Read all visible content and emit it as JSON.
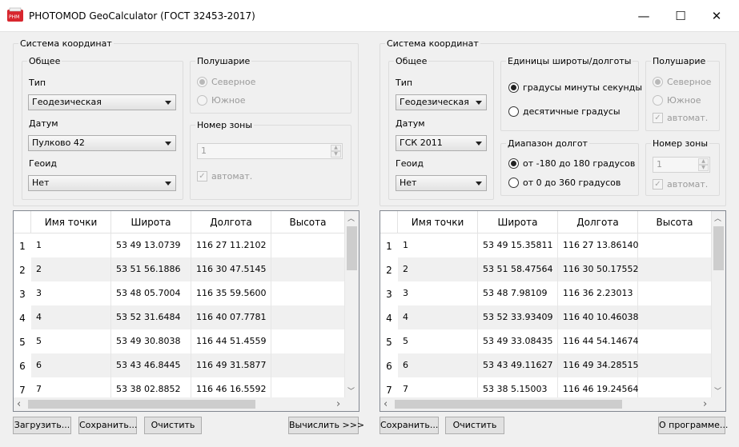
{
  "window": {
    "title": "PHOTOMOD GeoCalculator (ГОСТ 32453-2017)",
    "minimize": "—",
    "maximize": "☐",
    "close": "✕"
  },
  "left": {
    "group_title": "Система координат",
    "general_title": "Общее",
    "type_label": "Тип",
    "type_value": "Геодезическая",
    "datum_label": "Датум",
    "datum_value": "Пулково 42",
    "geoid_label": "Геоид",
    "geoid_value": "Нет",
    "hemisphere_title": "Полушарие",
    "north": "Северное",
    "south": "Южное",
    "zone_title": "Номер зоны",
    "zone_value": "1",
    "auto": "автомат."
  },
  "right": {
    "group_title": "Система координат",
    "general_title": "Общее",
    "type_label": "Тип",
    "type_value": "Геодезическая",
    "datum_label": "Датум",
    "datum_value": "ГСК 2011",
    "geoid_label": "Геоид",
    "geoid_value": "Нет",
    "units_title": "Единицы широты/долготы",
    "dms": "градусы минуты секунды",
    "decimal": "десятичные градусы",
    "range_title": "Диапазон долгот",
    "range1": "от -180 до 180 градусов",
    "range2": "от 0 до 360 градусов",
    "hemisphere_title": "Полушарие",
    "north": "Северное",
    "south": "Южное",
    "auto": "автомат.",
    "zone_title": "Номер зоны",
    "zone_value": "1"
  },
  "columns": [
    "Имя точки",
    "Широта",
    "Долгота",
    "Высота"
  ],
  "left_table": [
    {
      "n": "1",
      "name": "1",
      "lat": "53 49 13.0739",
      "lon": "116 27 11.2102",
      "h": ""
    },
    {
      "n": "2",
      "name": "2",
      "lat": "53 51 56.1886",
      "lon": "116 30 47.5145",
      "h": ""
    },
    {
      "n": "3",
      "name": "3",
      "lat": "53 48 05.7004",
      "lon": "116 35 59.5600",
      "h": ""
    },
    {
      "n": "4",
      "name": "4",
      "lat": "53 52 31.6484",
      "lon": "116 40 07.7781",
      "h": ""
    },
    {
      "n": "5",
      "name": "5",
      "lat": "53 49 30.8038",
      "lon": "116 44 51.4559",
      "h": ""
    },
    {
      "n": "6",
      "name": "6",
      "lat": "53 43 46.8445",
      "lon": "116 49 31.5877",
      "h": ""
    },
    {
      "n": "7",
      "name": "7",
      "lat": "53 38 02.8852",
      "lon": "116 46 16.5592",
      "h": ""
    }
  ],
  "right_table": [
    {
      "n": "1",
      "name": "1",
      "lat": "53 49 15.35811",
      "lon": "116 27 13.86140",
      "h": ""
    },
    {
      "n": "2",
      "name": "2",
      "lat": "53 51 58.47564",
      "lon": "116 30 50.17552",
      "h": ""
    },
    {
      "n": "3",
      "name": "3",
      "lat": "53 48 7.98109",
      "lon": "116 36 2.23013",
      "h": ""
    },
    {
      "n": "4",
      "name": "4",
      "lat": "53 52 33.93409",
      "lon": "116 40 10.46038",
      "h": ""
    },
    {
      "n": "5",
      "name": "5",
      "lat": "53 49 33.08435",
      "lon": "116 44 54.14674",
      "h": ""
    },
    {
      "n": "6",
      "name": "6",
      "lat": "53 43 49.11627",
      "lon": "116 49 34.28515",
      "h": ""
    },
    {
      "n": "7",
      "name": "7",
      "lat": "53 38 5.15003",
      "lon": "116 46 19.24564",
      "h": ""
    }
  ],
  "buttons": {
    "load": "Загрузить...",
    "save_left": "Сохранить...",
    "clear_left": "Очистить",
    "compute": "Вычислить >>>",
    "save_right": "Сохранить...",
    "clear_right": "Очистить",
    "about": "О программе..."
  }
}
